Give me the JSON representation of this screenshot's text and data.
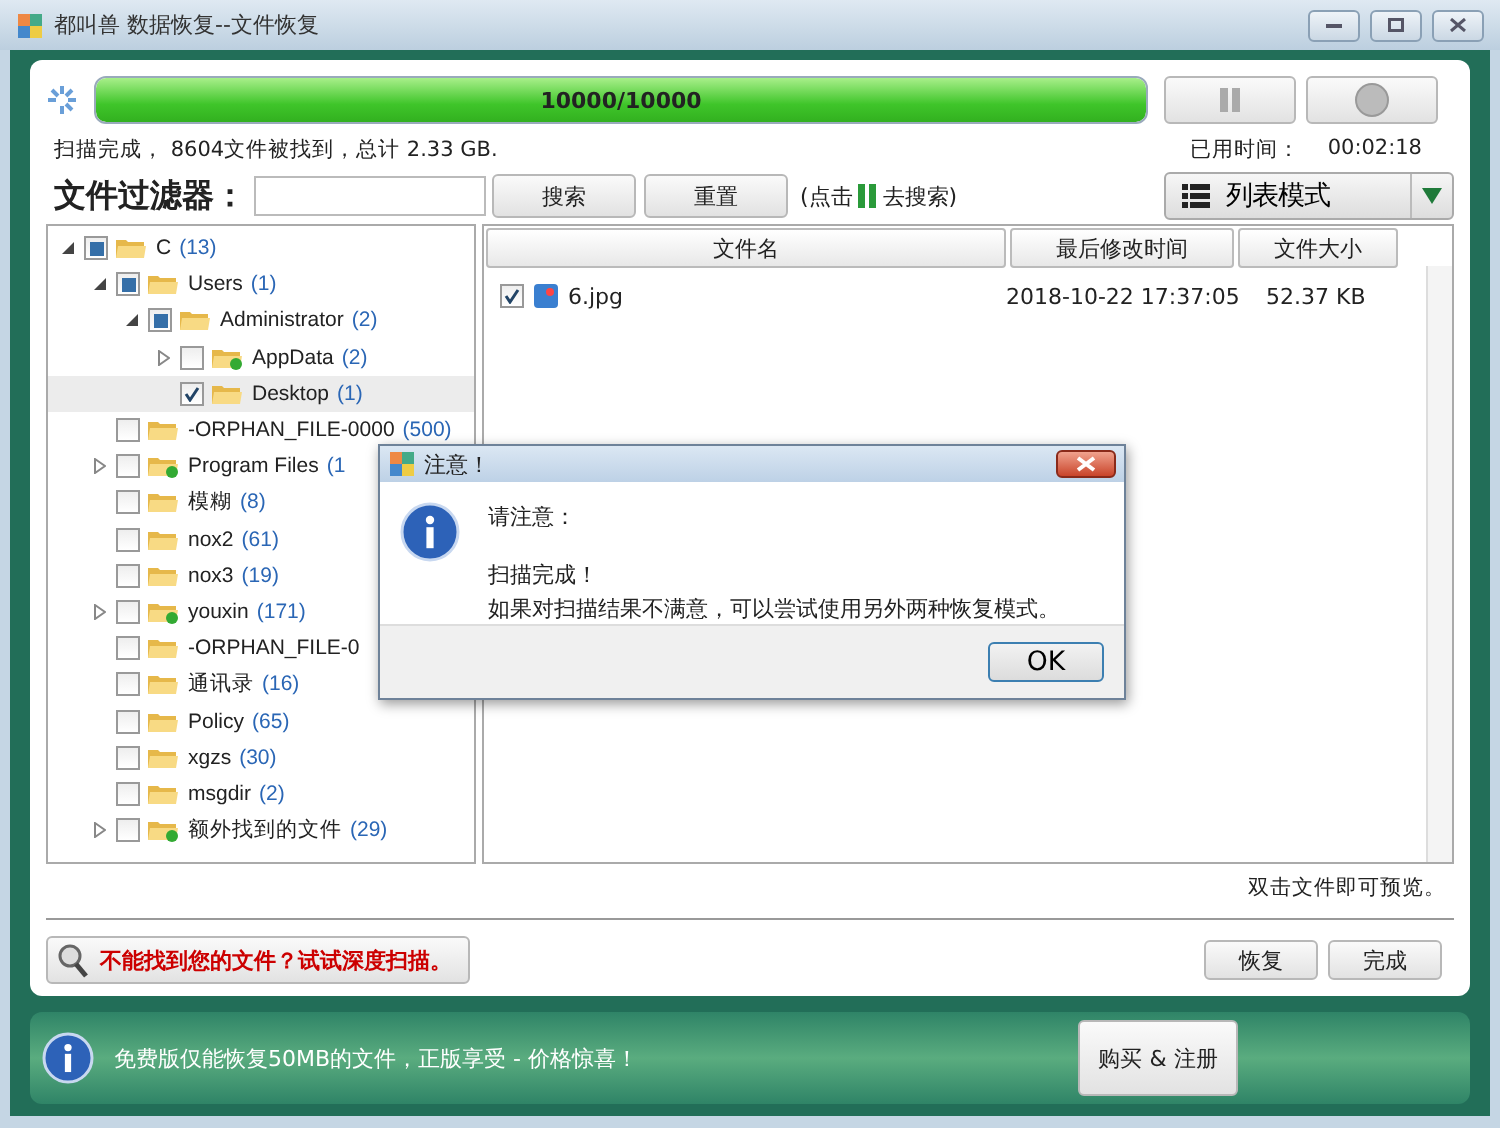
{
  "window": {
    "title": "都叫兽 数据恢复--文件恢复"
  },
  "progress": {
    "level": 1.0,
    "reading": "10000/10000"
  },
  "scan_status": "扫描完成， 8604文件被找到，总计 2.33 GB.",
  "elapsed": {
    "label": "已用时间：",
    "value": "00:02:18"
  },
  "filter": {
    "label": "文件过滤器：",
    "search_button": "搜索",
    "reset_button": "重置",
    "hint_before": "(点击",
    "hint_after": "去搜索)"
  },
  "view_mode": "列表模式",
  "tree": [
    {
      "name": "C",
      "count": "(13)",
      "checked": false,
      "partial": true,
      "expanded": true,
      "selected": false,
      "children": [
        {
          "name": "Users",
          "count": "(1)",
          "checked": false,
          "partial": true,
          "expanded": true,
          "selected": false,
          "children": [
            {
              "name": "Administrator",
              "count": "(2)",
              "checked": false,
              "partial": true,
              "expanded": true,
              "selected": false,
              "children": [
                {
                  "name": "AppData",
                  "count": "(2)",
                  "checked": false,
                  "partial": false,
                  "expanded": false,
                  "selected": false
                },
                {
                  "name": "Desktop",
                  "count": "(1)",
                  "checked": true,
                  "partial": false,
                  "selected": true
                }
              ]
            }
          ]
        },
        {
          "name": "-ORPHAN_FILE-0000",
          "count": "(500)",
          "checked": false,
          "partial": false,
          "selected": false
        },
        {
          "name": "Program Files",
          "count": "(1",
          "checked": false,
          "partial": false,
          "expanded": false,
          "selected": false
        },
        {
          "name": "模糊",
          "count": "(8)",
          "checked": false,
          "partial": false,
          "selected": false
        },
        {
          "name": "nox2",
          "count": "(61)",
          "checked": false,
          "partial": false,
          "selected": false
        },
        {
          "name": "nox3",
          "count": "(19)",
          "checked": false,
          "partial": false,
          "selected": false
        },
        {
          "name": "youxin",
          "count": "(171)",
          "checked": false,
          "partial": false,
          "expanded": false,
          "selected": false
        },
        {
          "name": "-ORPHAN_FILE-0",
          "checked": false,
          "partial": false,
          "selected": false
        },
        {
          "name": "通讯录",
          "count": "(16)",
          "checked": false,
          "partial": false,
          "selected": false
        },
        {
          "name": "Policy",
          "count": "(65)",
          "checked": false,
          "partial": false,
          "selected": false
        },
        {
          "name": "xgzs",
          "count": "(30)",
          "checked": false,
          "partial": false,
          "selected": false
        },
        {
          "name": "msgdir",
          "count": "(2)",
          "checked": false,
          "partial": false,
          "selected": false
        },
        {
          "name": "额外找到的文件",
          "count": "(29)",
          "checked": false,
          "partial": false,
          "expanded": false,
          "selected": false
        }
      ]
    }
  ],
  "table": {
    "columns": [
      "文件名",
      "最后修改时间",
      "文件大小"
    ],
    "rows": [
      {
        "checked": true,
        "name": "6.jpg",
        "modified": "2018-10-22 17:37:05",
        "size": "52.37 KB"
      }
    ]
  },
  "preview_hint": "双击文件即可预览。",
  "deep_scan_button": "不能找到您的文件？试试深度扫描。",
  "recover_button": "恢复",
  "finish_button": "完成",
  "banner": {
    "text": "免费版仅能恢复50MB的文件，正版享受 - 价格惊喜！",
    "buy_button": "购买 & 注册"
  },
  "dialog": {
    "title": "注意！",
    "heading": "请注意：",
    "lines": [
      "扫描完成！",
      "如果对扫描结果不满意，可以尝试使用另外两种恢复模式。"
    ],
    "ok_button": "OK"
  }
}
